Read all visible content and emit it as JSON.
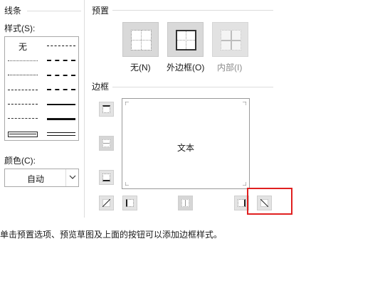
{
  "line_section": {
    "title": "线条",
    "style_label": "样式(S):",
    "none_option": "无",
    "color_label": "颜色(C):",
    "color_value": "自动",
    "color_dropdown_icon": "chevron-down-icon"
  },
  "preset_section": {
    "title": "预置",
    "buttons": [
      {
        "label": "无(N)",
        "icon": "border-none-icon",
        "enabled": true
      },
      {
        "label": "外边框(O)",
        "icon": "border-outside-icon",
        "enabled": true
      },
      {
        "label": "内部(I)",
        "icon": "border-inside-icon",
        "enabled": false
      }
    ]
  },
  "border_section": {
    "title": "边框",
    "preview_text": "文本",
    "buttons": [
      {
        "name": "border-top-button",
        "icon": "border-top-icon"
      },
      {
        "name": "border-inside-horizontal-button",
        "icon": "border-inside-horizontal-icon"
      },
      {
        "name": "border-bottom-button",
        "icon": "border-bottom-icon"
      },
      {
        "name": "border-diagonal-up-button",
        "icon": "diagonal-up-icon"
      },
      {
        "name": "border-left-button",
        "icon": "border-left-icon"
      },
      {
        "name": "border-inside-vertical-button",
        "icon": "border-inside-vertical-icon"
      },
      {
        "name": "border-right-button",
        "icon": "border-right-icon"
      },
      {
        "name": "border-diagonal-down-button",
        "icon": "diagonal-down-icon"
      }
    ]
  },
  "hint_text": "单击预置选项、预览草图及上面的按钮可以添加边框样式。",
  "colors": {
    "highlight": "#e02020",
    "button_bg": "#d9d9d9",
    "border_gray": "#a9a9a9"
  }
}
